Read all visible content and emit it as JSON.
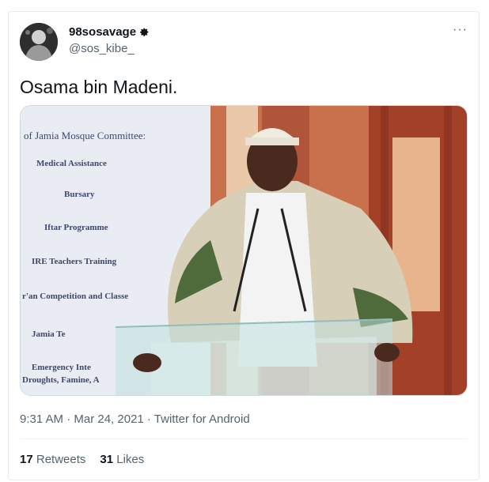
{
  "tweet": {
    "display_name": "98sosavage",
    "handle": "@sos_kibe_",
    "more_label": "···",
    "text": "Osama bin Madeni.",
    "timestamp": "9:31 AM · Mar 24, 2021 · Twitter for Android"
  },
  "stats": {
    "retweets_count": "17",
    "retweets_label": "Retweets",
    "likes_count": "31",
    "likes_label": "Likes"
  },
  "image": {
    "header": "of Jamia Mosque Committee:",
    "items": [
      "Medical Assistance",
      "Bursary",
      "Iftar Programme",
      "IRE Teachers Training",
      "r'an Competition and Classe",
      "Jamia Te",
      "Emergency Inte",
      "Droughts, Famine, A"
    ]
  },
  "colors": {
    "text": "#0f1419",
    "secondary": "#536471",
    "border": "#e6ecf0"
  }
}
